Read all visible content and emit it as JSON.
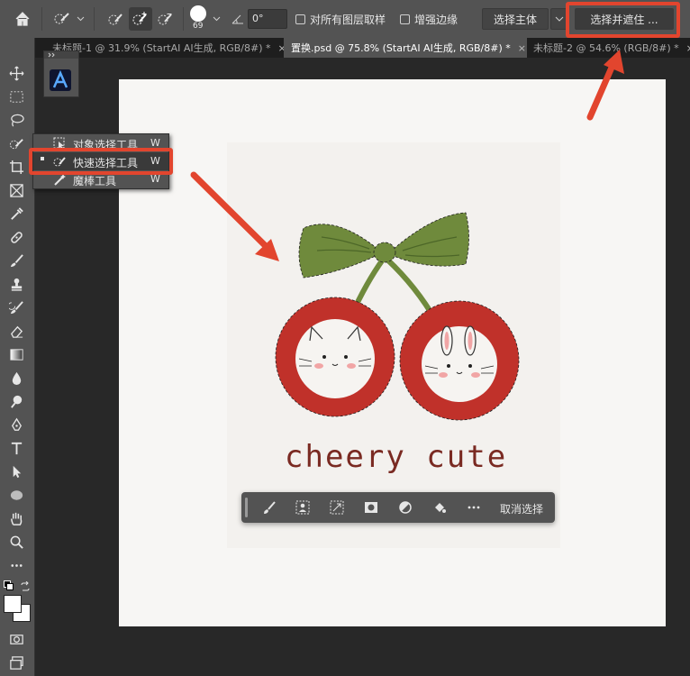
{
  "options_bar": {
    "brush_size": "69",
    "angle_value": "0°",
    "sample_all_layers_label": "对所有图层取样",
    "enhance_edge_label": "增强边缘",
    "select_subject_label": "选择主体",
    "select_and_mask_label": "选择并遮住 ..."
  },
  "tabs": [
    {
      "label": "未标题-1 @ 31.9% (StartAI AI生成, RGB/8#) *",
      "close": "×"
    },
    {
      "label": "置换.psd @ 75.8% (StartAI AI生成, RGB/8#) *",
      "close": "×"
    },
    {
      "label": "未标题-2 @ 54.6% (RGB/8#) *",
      "close": "×"
    }
  ],
  "flyout": {
    "items": [
      {
        "label": "对象选择工具",
        "key": "W"
      },
      {
        "label": "快速选择工具",
        "key": "W"
      },
      {
        "label": "魔棒工具",
        "key": "W"
      }
    ]
  },
  "artwork": {
    "text": "cheery cute"
  },
  "context_bar": {
    "deselect_label": "取消选择"
  },
  "colors": {
    "highlight_red": "#e2452e",
    "cherry_red": "#c0312a",
    "bow_green": "#6f8a3c",
    "app_gray": "#535353"
  },
  "icons": [
    "home-icon",
    "quick-select-icon",
    "brush-settings-icon",
    "new-selection-icon",
    "add-to-selection-icon",
    "subtract-selection-icon",
    "angle-icon",
    "move-icon",
    "marquee-icon",
    "lasso-icon",
    "crop-icon",
    "frame-icon",
    "eyedropper-icon",
    "healing-icon",
    "brush-icon",
    "stamp-icon",
    "history-brush-icon",
    "eraser-icon",
    "gradient-icon",
    "blur-icon",
    "dodge-icon",
    "pen-icon",
    "type-icon",
    "path-select-icon",
    "ellipse-icon",
    "hand-icon",
    "zoom-icon",
    "more-icon",
    "swap-colors-icon",
    "quick-mask-icon",
    "screen-mode-icon",
    "startai-logo-icon"
  ]
}
